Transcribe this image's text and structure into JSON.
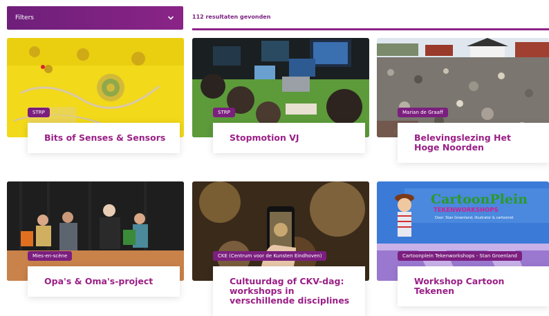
{
  "filters": {
    "label": "Filters",
    "icon": "chevron-down-icon"
  },
  "results": {
    "text": "112 resultaten gevonden"
  },
  "colors": {
    "accent": "#8a2488",
    "title": "#9a1f86",
    "tag_bg": "#7b1f7f"
  },
  "cards": [
    {
      "tag": "STRP",
      "title": "Bits of Senses & Sensors"
    },
    {
      "tag": "STRP",
      "title": "Stopmotion VJ"
    },
    {
      "tag": "Marian de Graaff",
      "title": "Belevingslezing Het Hoge Noorden"
    },
    {
      "tag": "Mies-en-scène",
      "title": "Opa's & Oma's-project"
    },
    {
      "tag": "CKE (Centrum voor de Kunsten Eindhoven)",
      "title": "Cultuurdag of CKV-dag: workshops in verschillende disciplines"
    },
    {
      "tag": "Cartoonplein Tekenworkshops - Stan Groenland",
      "title": "Workshop Cartoon Tekenen"
    }
  ],
  "cartoon_logo": {
    "line1": "CartoonPlein",
    "line2": "TEKENWORKSHOPS",
    "line3": "Door: Stan Groenland, illustrator & cartoonist"
  }
}
